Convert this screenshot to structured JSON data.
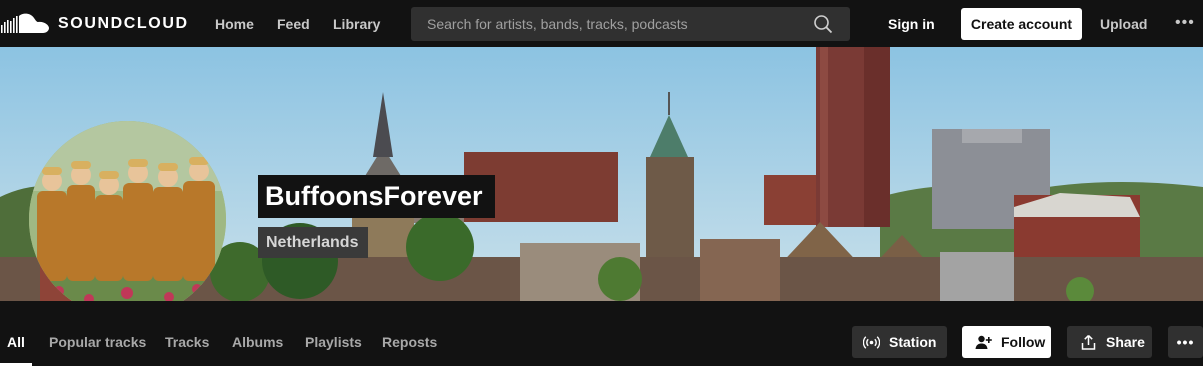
{
  "header": {
    "brand": "SOUNDCLOUD",
    "nav": [
      {
        "label": "Home"
      },
      {
        "label": "Feed"
      },
      {
        "label": "Library"
      }
    ],
    "search_placeholder": "Search for artists, bands, tracks, podcasts",
    "signin_label": "Sign in",
    "create_account_label": "Create account",
    "upload_label": "Upload",
    "more_label": "•••"
  },
  "profile": {
    "username": "BuffoonsForever",
    "location": "Netherlands"
  },
  "tabs": [
    {
      "label": "All",
      "active": true
    },
    {
      "label": "Popular tracks"
    },
    {
      "label": "Tracks"
    },
    {
      "label": "Albums"
    },
    {
      "label": "Playlists"
    },
    {
      "label": "Reposts"
    }
  ],
  "actions": {
    "station_label": "Station",
    "follow_label": "Follow",
    "share_label": "Share",
    "more_label": "•••"
  },
  "colors": {
    "background": "#121212",
    "search_bg": "#303030",
    "primary_button_bg": "#ffffff",
    "secondary_button_bg": "#303030",
    "sky": "#a9d0e6"
  },
  "icons": [
    "soundcloud-logo-icon",
    "search-icon",
    "station-icon",
    "follow-user-icon",
    "share-icon"
  ]
}
